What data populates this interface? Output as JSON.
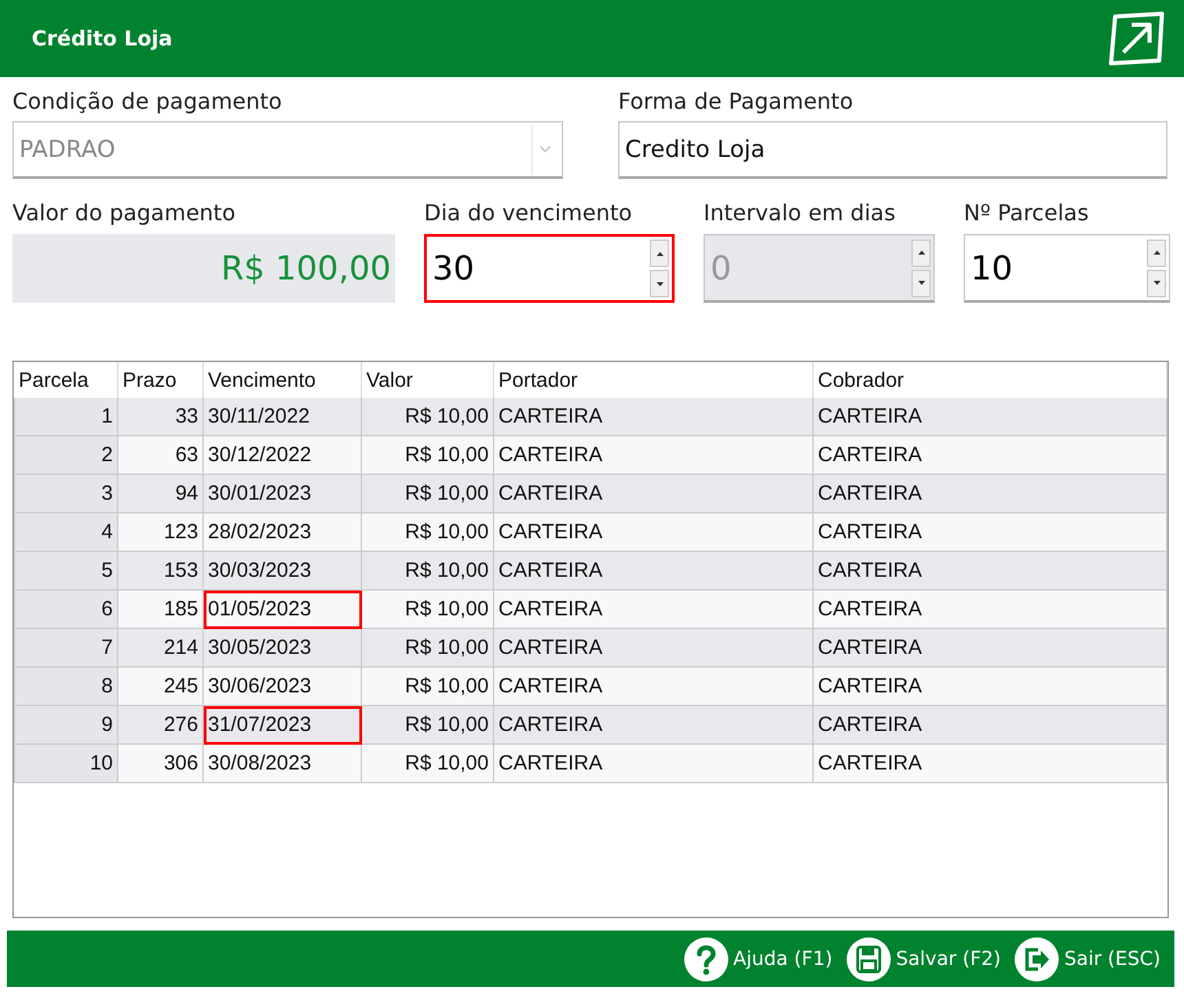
{
  "window": {
    "title": "Crédito Loja"
  },
  "fields": [
    {
      "kind": "select",
      "label": "Condição de pagamento",
      "value": "PADRAO",
      "disabled": true,
      "highlighted": false
    },
    {
      "kind": "text",
      "label": "Forma de Pagamento",
      "value": "Credito Loja",
      "highlighted": false
    },
    {
      "kind": "money",
      "label": "Valor do pagamento",
      "value": "R$ 100,00",
      "highlighted": false
    },
    {
      "kind": "spin",
      "label": "Dia do vencimento",
      "value": "30",
      "disabled": false,
      "highlighted": true
    },
    {
      "kind": "spin",
      "label": "Intervalo em dias",
      "value": "0",
      "disabled": true,
      "highlighted": false
    },
    {
      "kind": "spin",
      "label": "Nº Parcelas",
      "value": "10",
      "disabled": false,
      "highlighted": false
    }
  ],
  "table": {
    "columns": [
      "Parcela",
      "Prazo",
      "Vencimento",
      "Valor",
      "Portador",
      "Cobrador"
    ],
    "rows": [
      {
        "cells": [
          "1",
          "33",
          "30/11/2022",
          "R$ 10,00",
          "CARTEIRA",
          "CARTEIRA"
        ],
        "highlighted": false
      },
      {
        "cells": [
          "2",
          "63",
          "30/12/2022",
          "R$ 10,00",
          "CARTEIRA",
          "CARTEIRA"
        ],
        "highlighted": false
      },
      {
        "cells": [
          "3",
          "94",
          "30/01/2023",
          "R$ 10,00",
          "CARTEIRA",
          "CARTEIRA"
        ],
        "highlighted": false
      },
      {
        "cells": [
          "4",
          "123",
          "28/02/2023",
          "R$ 10,00",
          "CARTEIRA",
          "CARTEIRA"
        ],
        "highlighted": false
      },
      {
        "cells": [
          "5",
          "153",
          "30/03/2023",
          "R$ 10,00",
          "CARTEIRA",
          "CARTEIRA"
        ],
        "highlighted": false
      },
      {
        "cells": [
          "6",
          "185",
          "01/05/2023",
          "R$ 10,00",
          "CARTEIRA",
          "CARTEIRA"
        ],
        "highlighted": true
      },
      {
        "cells": [
          "7",
          "214",
          "30/05/2023",
          "R$ 10,00",
          "CARTEIRA",
          "CARTEIRA"
        ],
        "highlighted": false
      },
      {
        "cells": [
          "8",
          "245",
          "30/06/2023",
          "R$ 10,00",
          "CARTEIRA",
          "CARTEIRA"
        ],
        "highlighted": false
      },
      {
        "cells": [
          "9",
          "276",
          "31/07/2023",
          "R$ 10,00",
          "CARTEIRA",
          "CARTEIRA"
        ],
        "highlighted": true
      },
      {
        "cells": [
          "10",
          "306",
          "30/08/2023",
          "R$ 10,00",
          "CARTEIRA",
          "CARTEIRA"
        ],
        "highlighted": false
      }
    ]
  },
  "buttons": [
    {
      "kind": "help",
      "label": "Ajuda (F1)"
    },
    {
      "kind": "save",
      "label": "Salvar (F2)"
    },
    {
      "kind": "exit",
      "label": "Sair (ESC)"
    }
  ]
}
